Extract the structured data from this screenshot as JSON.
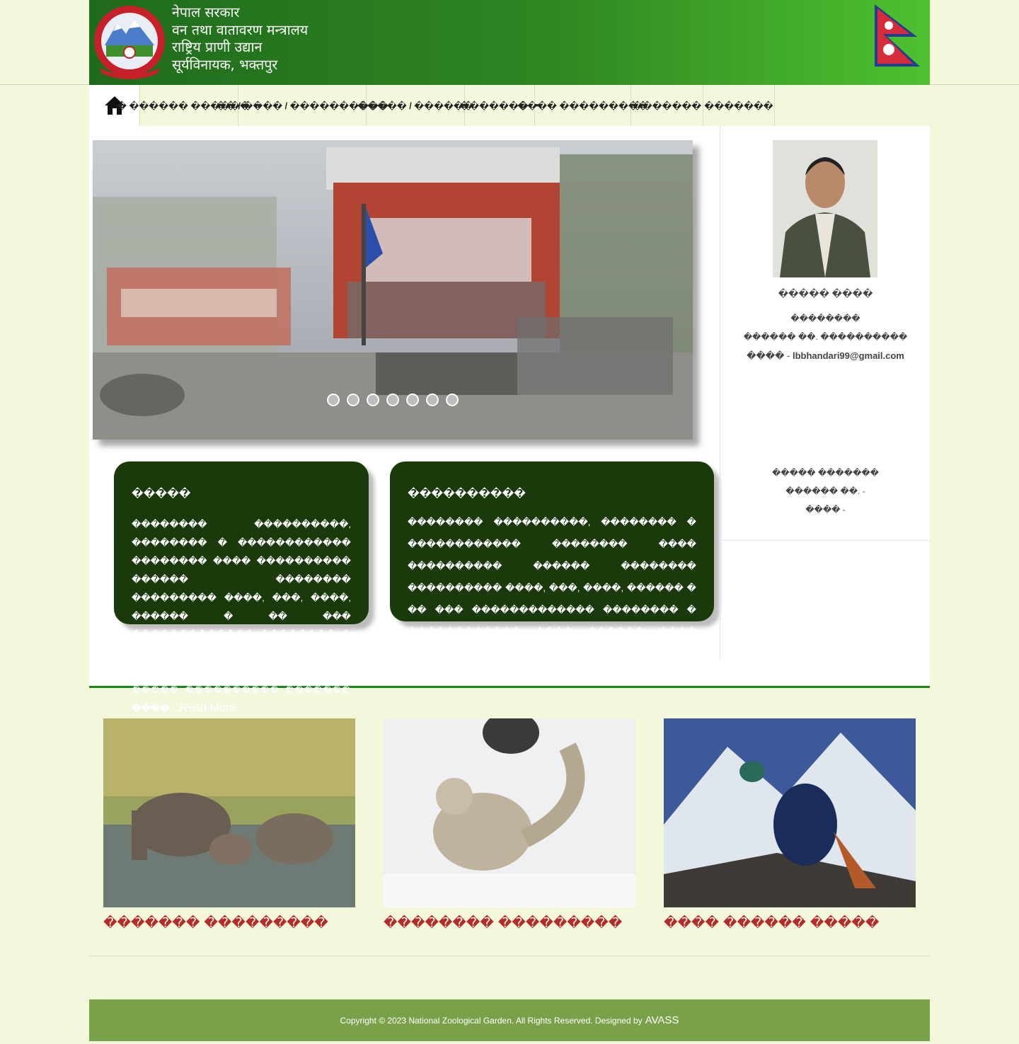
{
  "header": {
    "title_lines": [
      "नेपाल सरकार",
      "वन तथा वातावरण मन्त्रालय",
      "राष्ट्रिय प्राणी उद्यान",
      "सूर्यविनायक, भक्तपुर"
    ]
  },
  "nav": {
    "items": [
      {
        "label": "� ������ ������",
        "dropdown": true
      },
      {
        "label": "�� / ���� / ����������",
        "dropdown": false
      },
      {
        "label": "����� / ������",
        "dropdown": false
      },
      {
        "label": "�������",
        "dropdown": true
      },
      {
        "label": "���� ���������",
        "dropdown": false
      },
      {
        "label": "�������",
        "dropdown": false
      },
      {
        "label": "�������",
        "dropdown": false
      }
    ]
  },
  "slider": {
    "dots": 7
  },
  "cards": [
    {
      "title": "�����",
      "body": "�������� ����������, �������� � ������������ �������� ���� ���������� ������ �������� ��������� ����, ���, ����, ������ � �� ��� ������������� �������� � ������������ ���� ������ ���� ����� �������� � ���� ����� ���������� ������� ����....",
      "read_more": "Read More"
    },
    {
      "title": "����������",
      "body": "�������� ����������, �������� � ������������ �������� ���� ���������� ������ �������� ���������� ����, ���, ����, ������ � �� ��� ������������� �������� � ������������ ���� ������ ���� ����� �������� � ���� ����� ���������� ������� ����....",
      "read_more": "Read More"
    }
  ],
  "sidebar": {
    "person": {
      "name": "����� ����",
      "role": "��������",
      "phone": "������ ��. ����������",
      "email_label": "���� - ",
      "email": "lbbhandari99@gmail.com"
    },
    "info": {
      "role": "����� �������",
      "phone": "������ ��. -",
      "email": "���� -"
    }
  },
  "animals": [
    {
      "caption": "������� ���������"
    },
    {
      "caption": "�������� ���������"
    },
    {
      "caption": "���� ������ �����"
    }
  ],
  "footer": {
    "text": "Copyright © 2023 National Zoological Garden. All Rights Reserved. Designed by",
    "brand": "AVASS"
  }
}
